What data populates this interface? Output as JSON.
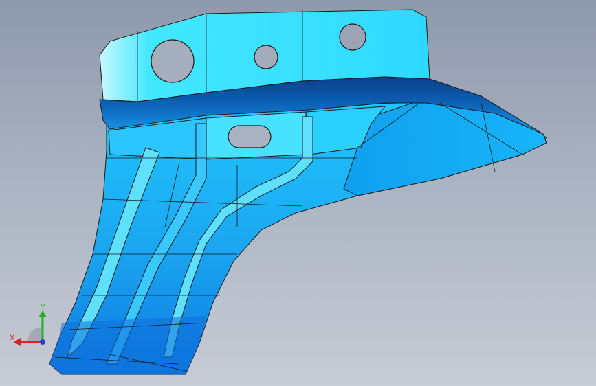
{
  "viewport": {
    "background_top": "#8e99ac",
    "background_bottom": "#c7ccd5"
  },
  "part": {
    "shade_light": "#43e8ff",
    "shade_mid": "#1ab3f2",
    "shade_dark": "#0a5fb0",
    "edge_color": "#1a1a1a"
  },
  "triad": {
    "x_label": "X",
    "y_label": "Y",
    "x_color": "#e02020",
    "y_color": "#20b020",
    "z_color": "#2040e0"
  }
}
